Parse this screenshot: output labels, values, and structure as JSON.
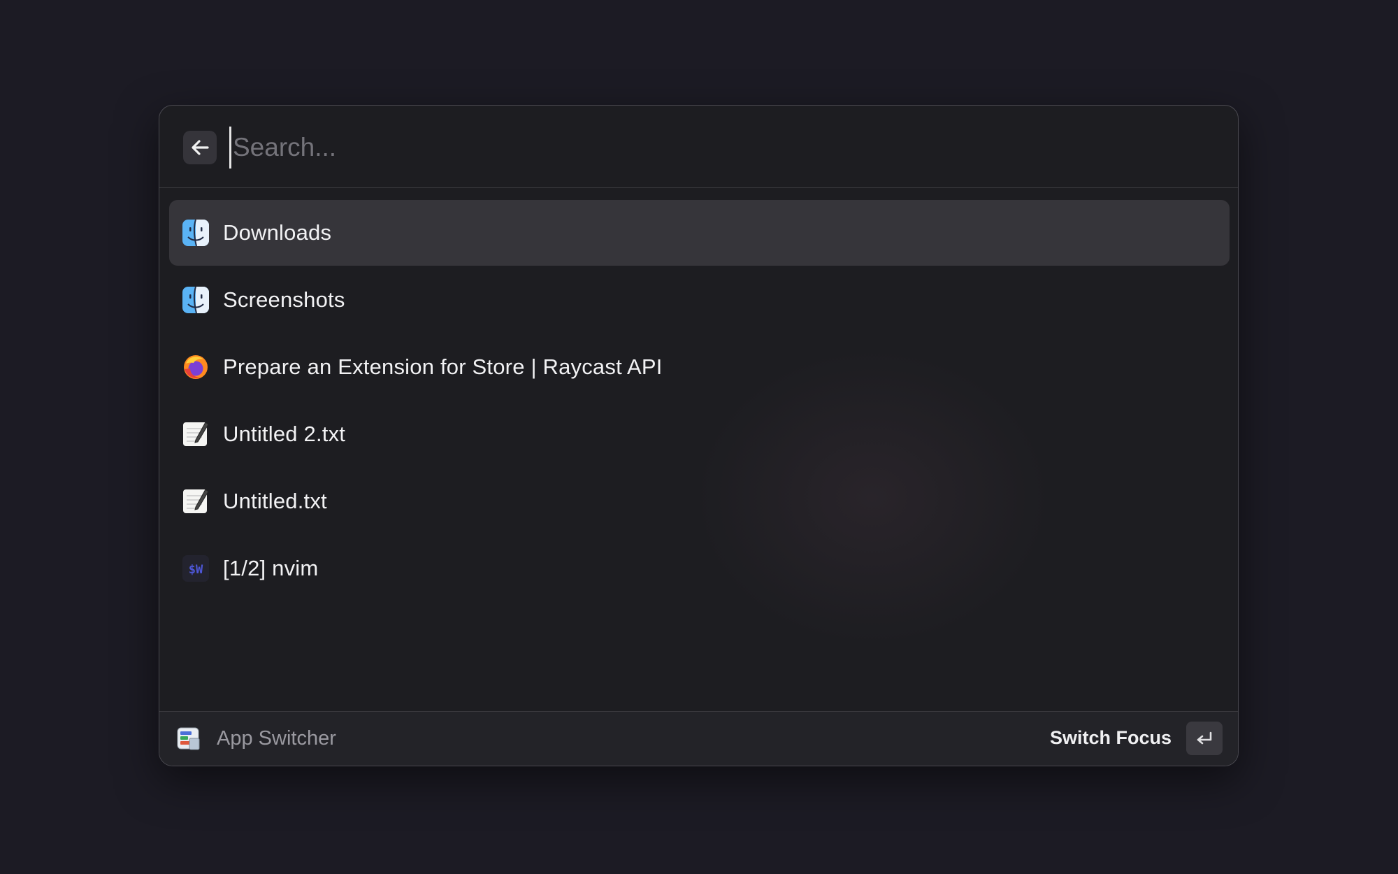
{
  "search": {
    "placeholder": "Search...",
    "value": ""
  },
  "results": [
    {
      "label": "Downloads",
      "icon": "finder-icon",
      "selected": true
    },
    {
      "label": "Screenshots",
      "icon": "finder-icon",
      "selected": false
    },
    {
      "label": "Prepare an Extension for Store | Raycast API",
      "icon": "firefox-icon",
      "selected": false
    },
    {
      "label": "Untitled 2.txt",
      "icon": "textedit-icon",
      "selected": false
    },
    {
      "label": "Untitled.txt",
      "icon": "textedit-icon",
      "selected": false
    },
    {
      "label": "[1/2] nvim",
      "icon": "wezterm-icon",
      "selected": false
    }
  ],
  "wezterm_icon_text": "$W",
  "footer": {
    "app_name": "App Switcher",
    "action_label": "Switch Focus",
    "action_key": "↵"
  },
  "colors": {
    "selection": "#36353a",
    "background": "#1c1b24"
  }
}
